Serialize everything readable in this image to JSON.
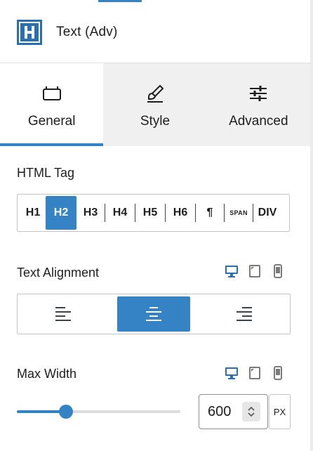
{
  "block": {
    "title": "Text (Adv)",
    "icon": "heading-h-icon"
  },
  "tabs": [
    {
      "label": "General",
      "icon": "general-tab-icon",
      "active": true
    },
    {
      "label": "Style",
      "icon": "brush-icon",
      "active": false
    },
    {
      "label": "Advanced",
      "icon": "sliders-icon",
      "active": false
    }
  ],
  "html_tag": {
    "label": "HTML Tag",
    "options": [
      "H1",
      "H2",
      "H3",
      "H4",
      "H5",
      "H6",
      "¶",
      "SPAN",
      "DIV"
    ],
    "selected": "H2"
  },
  "text_alignment": {
    "label": "Text Alignment",
    "options": [
      "align-left",
      "align-center",
      "align-right"
    ],
    "selected": "align-center",
    "devices": [
      "desktop-icon",
      "tablet-icon",
      "mobile-icon"
    ],
    "active_device": "desktop-icon"
  },
  "max_width": {
    "label": "Max Width",
    "value": "600",
    "unit": "PX",
    "slider_fraction": 0.3,
    "devices": [
      "desktop-icon",
      "tablet-icon",
      "mobile-icon"
    ],
    "active_device": "desktop-icon"
  },
  "colors": {
    "accent": "#3582c4",
    "text": "#1e1e1e",
    "inactive_tab_bg": "#f0f0f0",
    "border": "#c3c4c7"
  }
}
